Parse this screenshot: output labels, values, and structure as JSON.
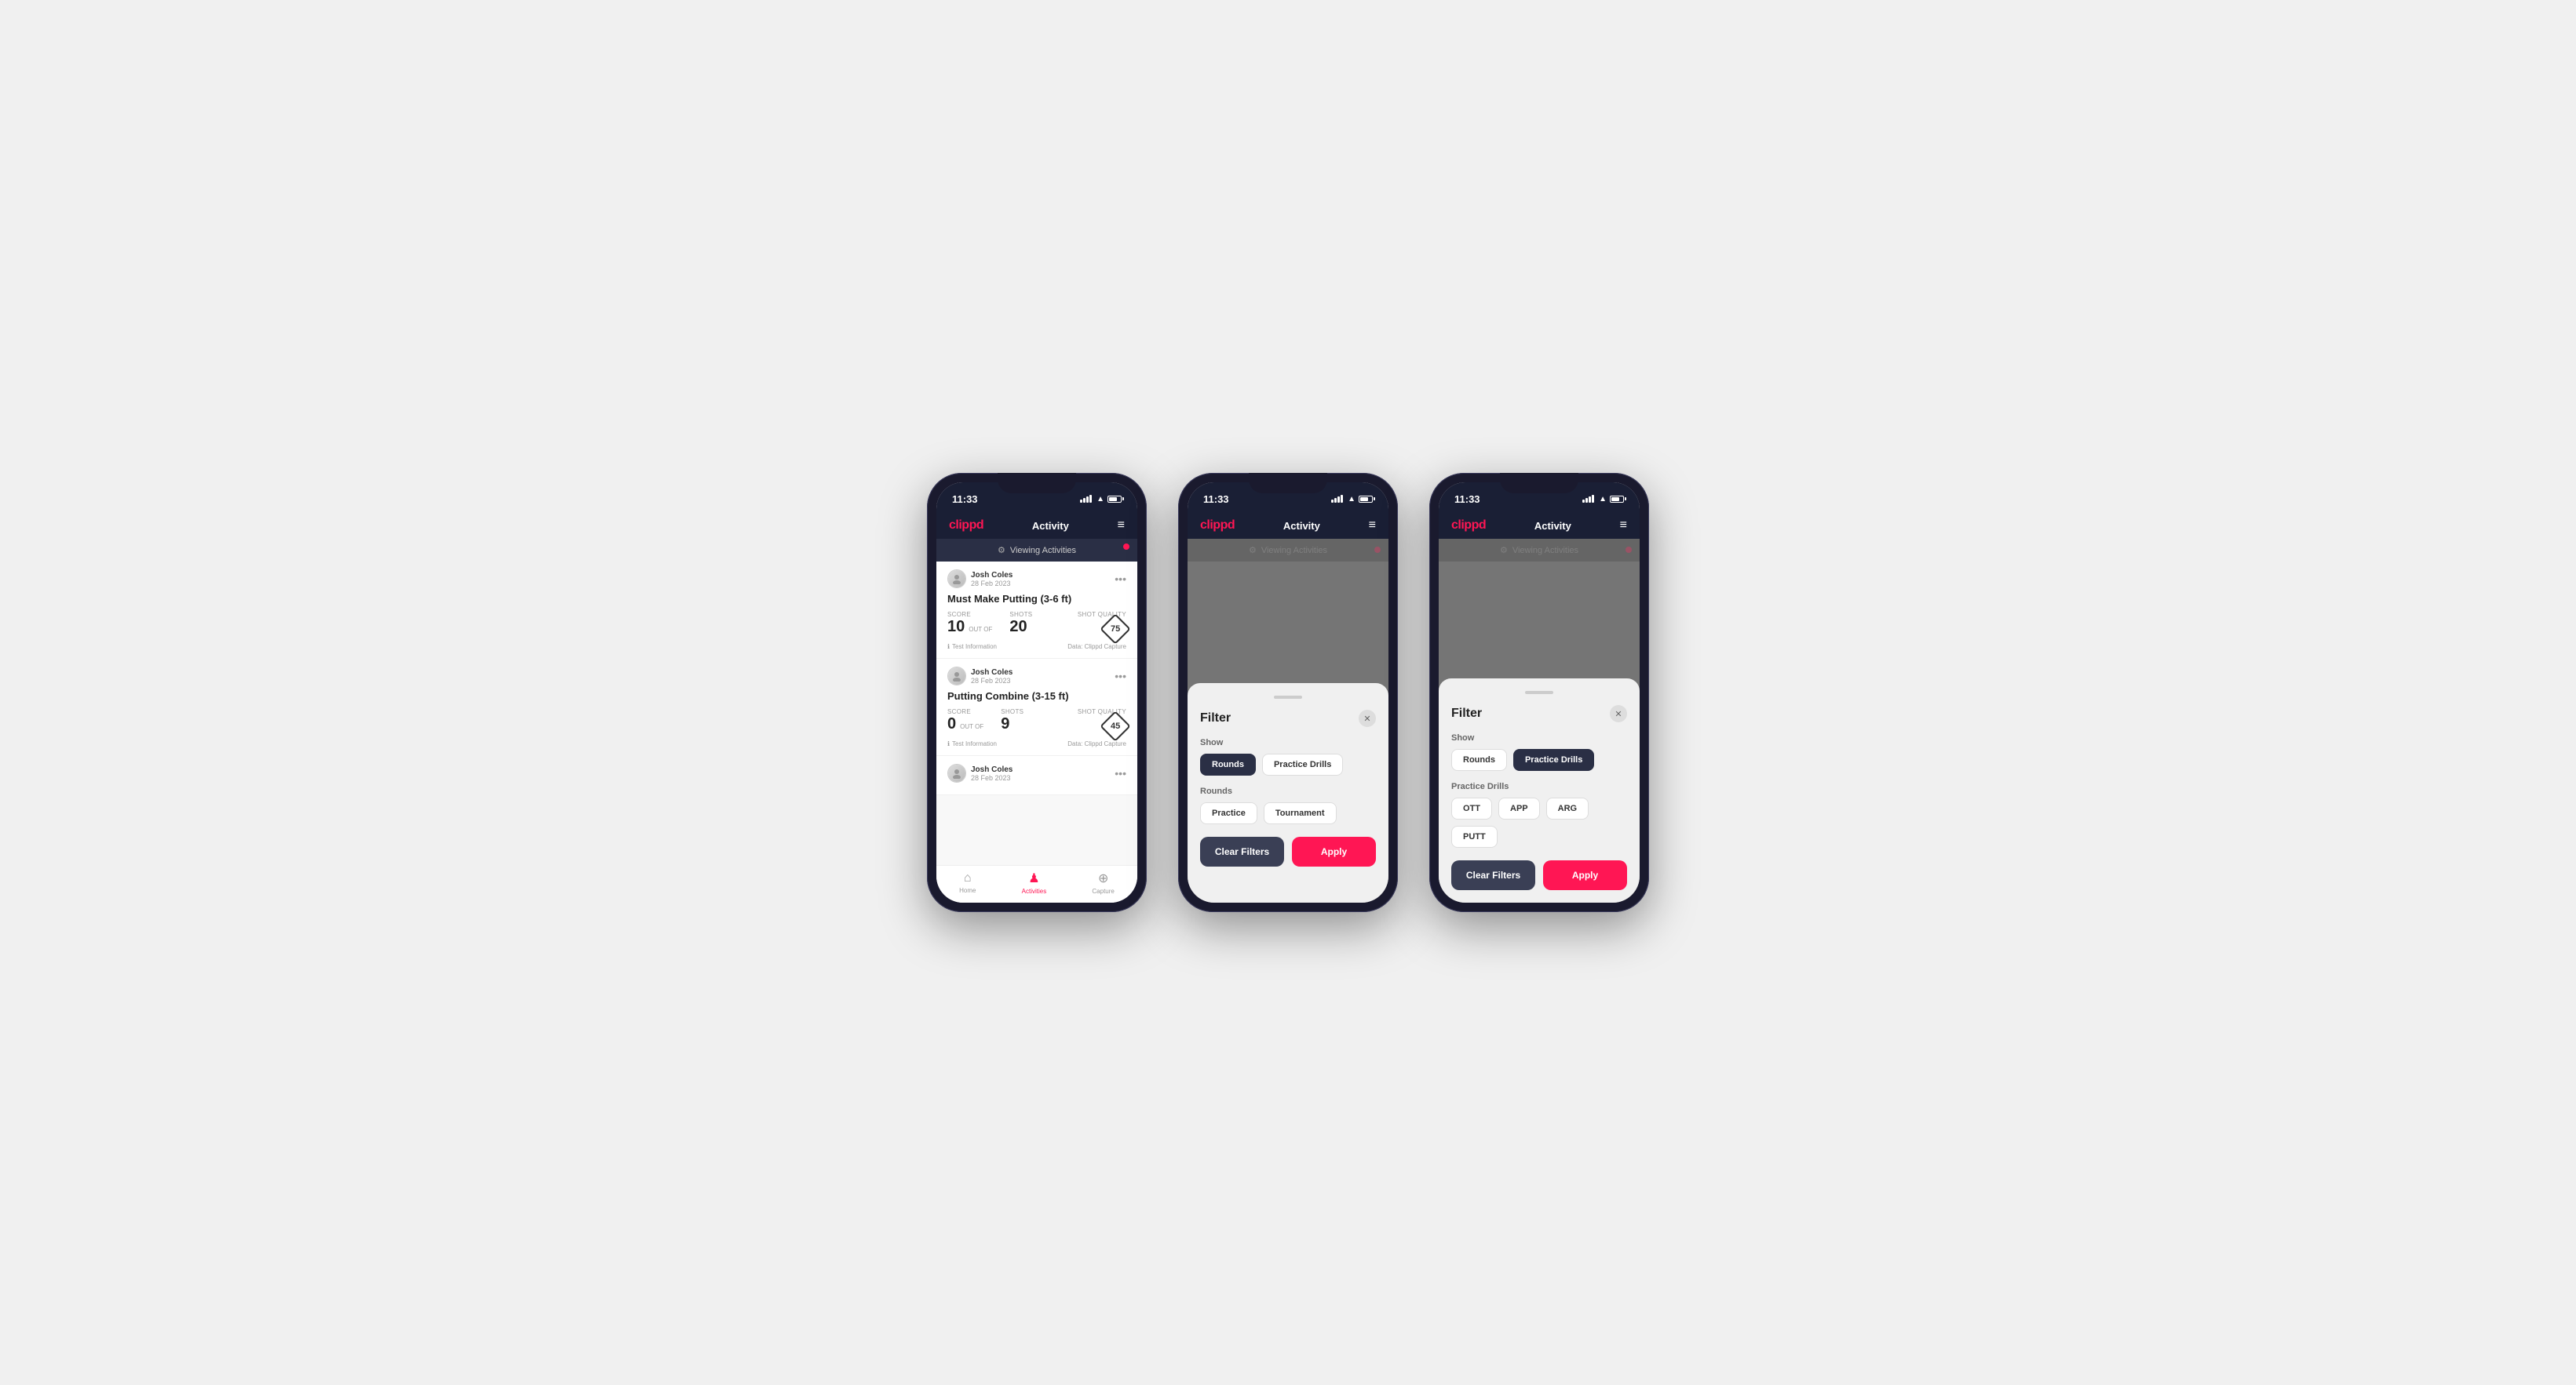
{
  "app": {
    "logo": "clippd",
    "header_title": "Activity",
    "time": "11:33"
  },
  "viewing_bar": {
    "label": "Viewing Activities"
  },
  "phone1": {
    "cards": [
      {
        "user_name": "Josh Coles",
        "date": "28 Feb 2023",
        "title": "Must Make Putting (3-6 ft)",
        "score_label": "Score",
        "score": "10",
        "out_of": "OUT OF",
        "shots_label": "Shots",
        "shots": "20",
        "shot_quality_label": "Shot Quality",
        "shot_quality": "75",
        "test_info": "Test Information",
        "data_source": "Data: Clippd Capture"
      },
      {
        "user_name": "Josh Coles",
        "date": "28 Feb 2023",
        "title": "Putting Combine (3-15 ft)",
        "score_label": "Score",
        "score": "0",
        "out_of": "OUT OF",
        "shots_label": "Shots",
        "shots": "9",
        "shot_quality_label": "Shot Quality",
        "shot_quality": "45",
        "test_info": "Test Information",
        "data_source": "Data: Clippd Capture"
      },
      {
        "user_name": "Josh Coles",
        "date": "28 Feb 2023",
        "title": "",
        "score_label": "",
        "score": "",
        "out_of": "",
        "shots_label": "",
        "shots": "",
        "shot_quality_label": "",
        "shot_quality": "",
        "test_info": "",
        "data_source": ""
      }
    ],
    "nav": {
      "home": "Home",
      "activities": "Activities",
      "capture": "Capture"
    }
  },
  "phone2": {
    "filter": {
      "title": "Filter",
      "show_label": "Show",
      "rounds_btn": "Rounds",
      "practice_drills_btn": "Practice Drills",
      "rounds_section_label": "Rounds",
      "practice_btn": "Practice",
      "tournament_btn": "Tournament",
      "clear_filters": "Clear Filters",
      "apply": "Apply",
      "rounds_active": true,
      "practice_drills_active": false,
      "practice_round_active": false,
      "tournament_round_active": false
    }
  },
  "phone3": {
    "filter": {
      "title": "Filter",
      "show_label": "Show",
      "rounds_btn": "Rounds",
      "practice_drills_btn": "Practice Drills",
      "practice_drills_section_label": "Practice Drills",
      "ott_btn": "OTT",
      "app_btn": "APP",
      "arg_btn": "ARG",
      "putt_btn": "PUTT",
      "clear_filters": "Clear Filters",
      "apply": "Apply",
      "rounds_active": false,
      "practice_drills_active": true
    }
  }
}
